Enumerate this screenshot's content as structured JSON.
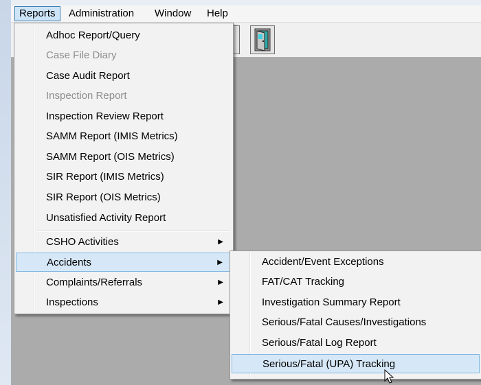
{
  "menubar": {
    "items": [
      "Reports",
      "Administration",
      "Window",
      "Help"
    ]
  },
  "reports_menu": {
    "items": [
      {
        "label": "Adhoc Report/Query",
        "enabled": true
      },
      {
        "label": "Case File Diary",
        "enabled": false
      },
      {
        "label": "Case Audit Report",
        "enabled": true
      },
      {
        "label": "Inspection Report",
        "enabled": false
      },
      {
        "label": "Inspection Review Report",
        "enabled": true
      },
      {
        "label": "SAMM Report (IMIS Metrics)",
        "enabled": true
      },
      {
        "label": "SAMM Report (OIS Metrics)",
        "enabled": true
      },
      {
        "label": "SIR Report (IMIS Metrics)",
        "enabled": true
      },
      {
        "label": "SIR Report (OIS Metrics)",
        "enabled": true
      },
      {
        "label": "Unsatisfied Activity Report",
        "enabled": true
      }
    ],
    "submenus": [
      {
        "label": "CSHO Activities",
        "arrow": "▶"
      },
      {
        "label": "Accidents",
        "arrow": "▶",
        "highlighted": true
      },
      {
        "label": "Complaints/Referrals",
        "arrow": "▶"
      },
      {
        "label": "Inspections",
        "arrow": "▶"
      }
    ]
  },
  "accidents_submenu": {
    "items": [
      "Accident/Event Exceptions",
      "FAT/CAT Tracking",
      "Investigation Summary Report",
      "Serious/Fatal Causes/Investigations",
      "Serious/Fatal Log Report",
      "Serious/Fatal (UPA) Tracking"
    ],
    "highlighted_index": 5
  },
  "icons": {
    "toolbar_button": "door-exit-icon",
    "pointer": "mouse-cursor-icon"
  },
  "colors": {
    "mdi_background": "#ababab",
    "highlight_fill": "#d6e8f7",
    "highlight_border": "#80b7e3",
    "disabled_text": "#8d8d8d"
  }
}
